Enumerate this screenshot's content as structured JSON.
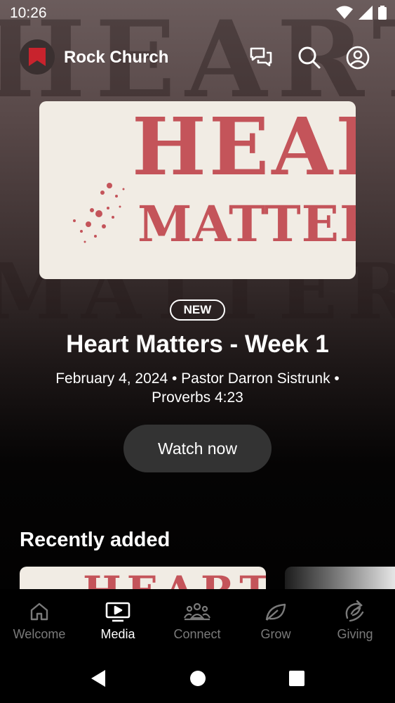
{
  "status_bar": {
    "time": "10:26"
  },
  "app_bar": {
    "title": "Rock Church"
  },
  "hero": {
    "artwork_line1": "HEART",
    "artwork_line2": "MATTERS",
    "badge": "NEW",
    "title": "Heart Matters - Week 1",
    "meta": "February 4, 2024 • Pastor Darron Sistrunk • Proverbs 4:23",
    "cta": "Watch now"
  },
  "recent": {
    "title": "Recently added",
    "card1_artwork": "HEART"
  },
  "bottom_nav": {
    "items": [
      {
        "label": "Welcome",
        "icon": "home-icon"
      },
      {
        "label": "Media",
        "icon": "tv-icon"
      },
      {
        "label": "Connect",
        "icon": "group-icon"
      },
      {
        "label": "Grow",
        "icon": "leaf-icon"
      },
      {
        "label": "Giving",
        "icon": "giving-icon"
      }
    ],
    "active": "Media"
  },
  "colors": {
    "accent": "#c4545a",
    "artwork_bg": "#f1ece4",
    "button_bg": "#333333",
    "inactive_nav": "#7a7a7a"
  }
}
